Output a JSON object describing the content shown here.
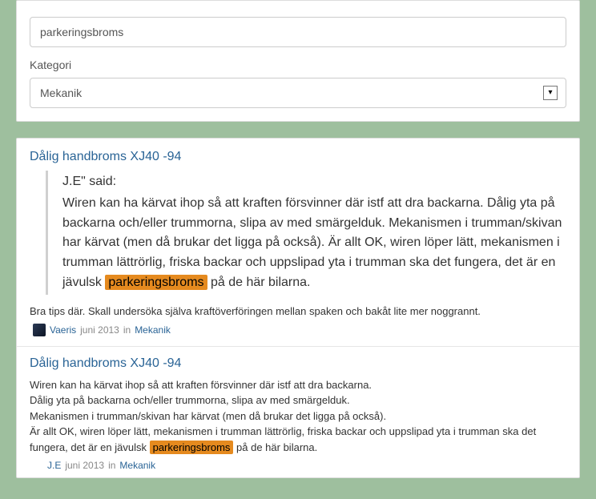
{
  "search": {
    "query": "parkeringsbroms",
    "category_label": "Kategori",
    "selected_category": "Mekanik"
  },
  "results": [
    {
      "title": "Dålig handbroms XJ40 -94",
      "quote_author": "J.E\" said:",
      "quote_text_pre": "Wiren kan ha kärvat ihop så att kraften försvinner där istf att dra backarna. Dålig yta på backarna och/eller trummorna, slipa av med smärgelduk. Mekanismen i trumman/skivan har kärvat (men då brukar det ligga på också). Är allt OK, wiren löper lätt, mekanismen i trumman lättrörlig, friska backar och uppslipad yta i trumman ska det fungera, det är en jävulsk ",
      "quote_highlight": "parkeringsbroms",
      "quote_text_post": " på de här bilarna.",
      "snippet": "Bra tips där. Skall undersöka själva kraftöverföringen mellan spaken och bakåt lite mer noggrannt.",
      "author": "Vaeris",
      "date": "juni 2013",
      "in": "in",
      "category": "Mekanik"
    },
    {
      "title": "Dålig handbroms XJ40 -94",
      "body_pre": "Wiren kan ha kärvat ihop så att kraften försvinner där istf att dra backarna.\nDålig yta på backarna och/eller trummorna, slipa av med smärgelduk.\nMekanismen i trumman/skivan har kärvat (men då brukar det ligga på också).\nÄr allt OK, wiren löper lätt, mekanismen i trumman lättrörlig, friska backar och uppslipad yta i trumman ska det fungera, det är en jävulsk ",
      "body_highlight": "parkeringsbroms",
      "body_post": " på de här bilarna.",
      "author": "J.E",
      "date": "juni 2013",
      "in": "in",
      "category": "Mekanik"
    }
  ]
}
